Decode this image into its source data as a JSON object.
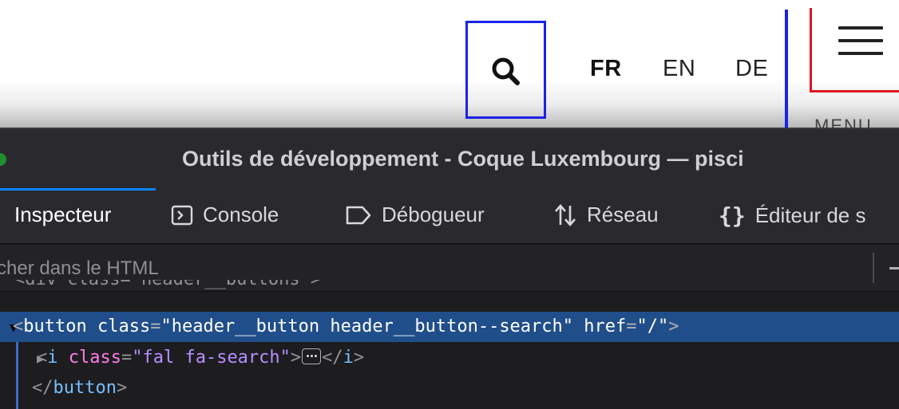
{
  "header": {
    "search_icon": "search-icon",
    "languages": [
      {
        "code": "FR",
        "active": true
      },
      {
        "code": "EN",
        "active": false
      },
      {
        "code": "DE",
        "active": false
      }
    ],
    "menu_icon": "hamburger-icon",
    "menu_label": "MENU"
  },
  "devtools": {
    "window_title": "Outils de développement - Coque Luxembourg — pisci",
    "tabs": [
      {
        "label": "Inspecteur",
        "icon": "",
        "active": true
      },
      {
        "label": "Console",
        "icon": "console-icon",
        "active": false
      },
      {
        "label": "Débogueur",
        "icon": "debugger-icon",
        "active": false
      },
      {
        "label": "Réseau",
        "icon": "network-icon",
        "active": false
      },
      {
        "label": "Éditeur de s",
        "icon": "braces-icon",
        "active": false
      }
    ],
    "search_placeholder": "cher dans le HTML",
    "markup": {
      "cut_line": "<div class=\"header__buttons\">",
      "selected": {
        "open": "<",
        "tag": "button",
        "attr1": "class",
        "val1": "\"header__button header__button--search\"",
        "attr2": "href",
        "val2": "\"/\"",
        "close": ">"
      },
      "child": {
        "open": "<",
        "tag": "i",
        "attr": "class",
        "val": "\"fal fa-search\"",
        "gt": ">",
        "end": "</",
        "end_tag": "i",
        "end_gt": ">"
      },
      "closing": {
        "open": "</",
        "tag": "button",
        "gt": ">"
      }
    }
  },
  "colors": {
    "search_outline": "#1b22e6",
    "menu_outline": "#e0141e",
    "selection": "#204e8a",
    "tag": "#75bfff",
    "attribute": "#ff7de9",
    "value": "#b98eff"
  }
}
